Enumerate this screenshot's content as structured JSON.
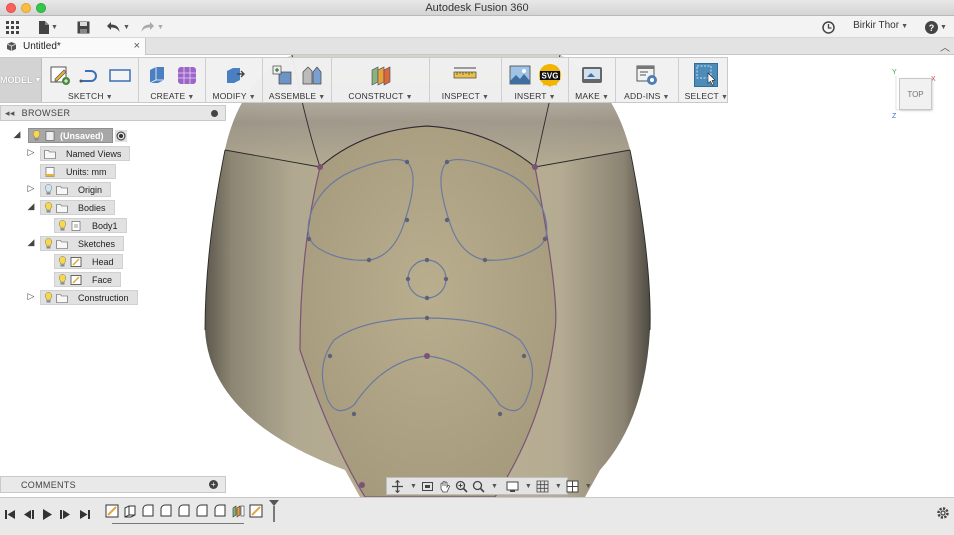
{
  "window": {
    "title": "Autodesk Fusion 360"
  },
  "appbar": {
    "user_name": "Birkir Thor",
    "help": "?"
  },
  "tabs": [
    {
      "label": "Untitled*",
      "close": "×"
    }
  ],
  "toolbar": {
    "workspace": "MODEL",
    "groups": [
      {
        "label": "SKETCH"
      },
      {
        "label": "CREATE"
      },
      {
        "label": "MODIFY"
      },
      {
        "label": "ASSEMBLE"
      },
      {
        "label": "CONSTRUCT"
      },
      {
        "label": "INSPECT"
      },
      {
        "label": "INSERT"
      },
      {
        "label": "MAKE"
      },
      {
        "label": "ADD-INS"
      },
      {
        "label": "SELECT"
      }
    ],
    "svg_badge": "SVG"
  },
  "browser": {
    "title": "BROWSER",
    "root": "(Unsaved)",
    "named_views": "Named Views",
    "units": "Units: mm",
    "origin": "Origin",
    "bodies": "Bodies",
    "body1": "Body1",
    "sketches": "Sketches",
    "head": "Head",
    "face": "Face",
    "construction": "Construction"
  },
  "comments": {
    "title": "COMMENTS"
  },
  "viewcube": {
    "face": "TOP",
    "axis_x": "X",
    "axis_y": "Y",
    "axis_z": "Z"
  },
  "colors": {
    "toolbar_active": "#4d8cb8",
    "sketch_line": "#7c5276",
    "sketch_curve": "#6b79a0",
    "body_fill": "#a39b85"
  }
}
